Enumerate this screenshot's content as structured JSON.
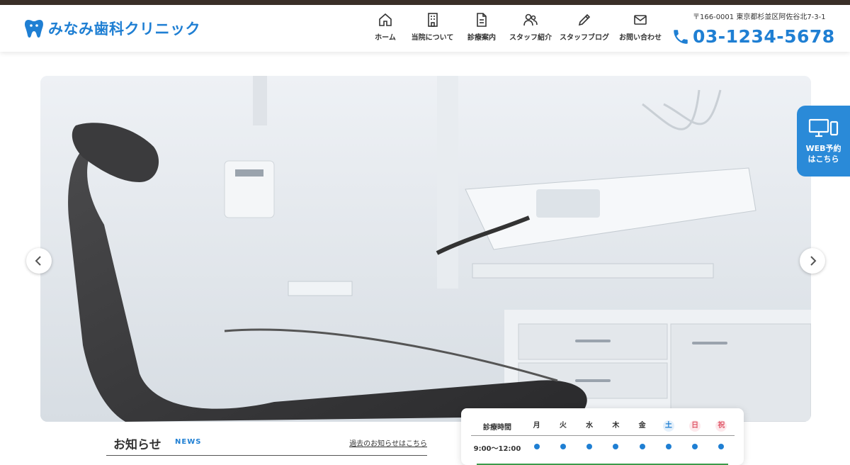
{
  "logo": {
    "name": "みなみ歯科クリニック",
    "icon": "tooth-icon",
    "color": "#1f7fd3"
  },
  "nav": {
    "items": [
      {
        "label": "ホーム",
        "icon": "home-icon"
      },
      {
        "label": "当院について",
        "icon": "building-icon"
      },
      {
        "label": "診療案内",
        "icon": "document-icon"
      },
      {
        "label": "スタッフ紹介",
        "icon": "people-icon"
      },
      {
        "label": "スタッフブログ",
        "icon": "pencil-icon"
      },
      {
        "label": "お問い合わせ",
        "icon": "mail-icon"
      }
    ]
  },
  "contact": {
    "address": "〒166-0001 東京都杉並区阿佐谷北7-3-1",
    "phone": "03-1234-5678"
  },
  "web_booking": {
    "line1": "WEB予約",
    "line2": "はこちら",
    "icon": "devices-icon",
    "color": "#2a8ad8"
  },
  "news": {
    "title": "お知らせ",
    "subtitle": "NEWS",
    "archive_link": "過去のお知らせはこちら"
  },
  "hours": {
    "header_label": "診療時間",
    "days": [
      {
        "label": "月",
        "type": "weekday"
      },
      {
        "label": "火",
        "type": "weekday"
      },
      {
        "label": "水",
        "type": "weekday"
      },
      {
        "label": "木",
        "type": "weekday"
      },
      {
        "label": "金",
        "type": "weekday"
      },
      {
        "label": "土",
        "type": "sat"
      },
      {
        "label": "日",
        "type": "sun"
      },
      {
        "label": "祝",
        "type": "sun"
      }
    ],
    "rows": [
      {
        "time": "9:00〜12:00",
        "open": [
          true,
          true,
          true,
          true,
          true,
          true,
          true,
          true
        ]
      }
    ]
  },
  "colors": {
    "accent": "#1f7fd3",
    "topbar": "#3a2f28",
    "sunday": "#e05a6b"
  }
}
